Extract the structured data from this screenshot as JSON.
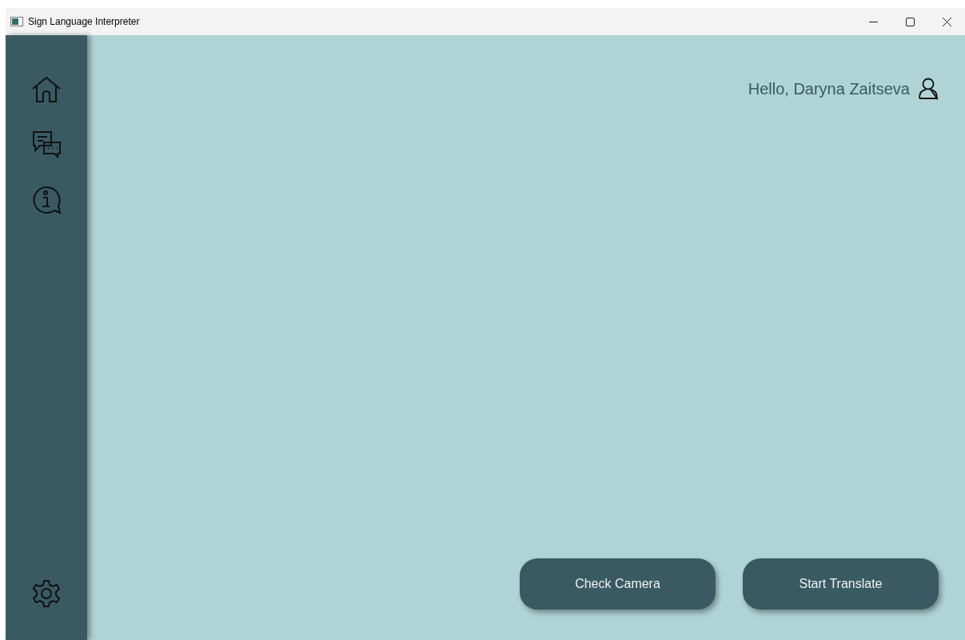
{
  "window": {
    "title": "Sign Language Interpreter"
  },
  "greeting": "Hello, Daryna Zaitseva",
  "buttons": [
    "Check Camera",
    "Start Translate"
  ]
}
